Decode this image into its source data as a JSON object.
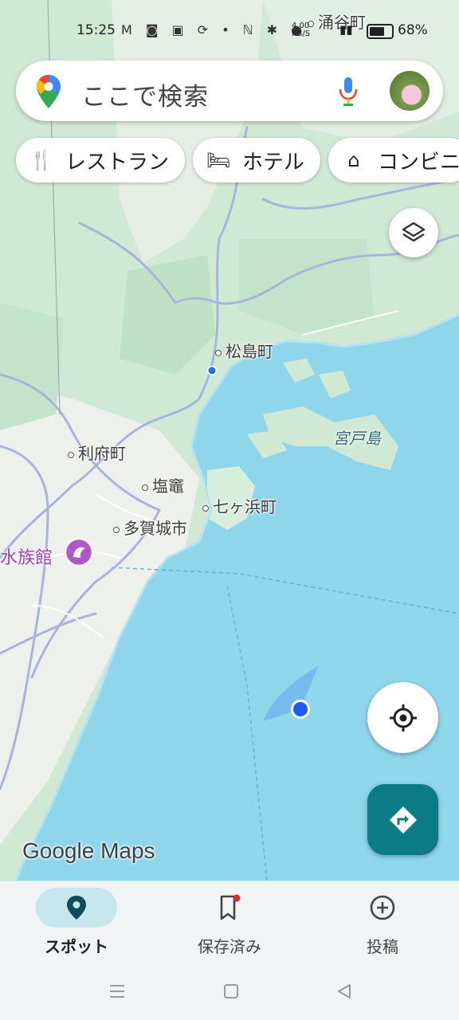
{
  "status_bar": {
    "time": "15:25",
    "network_speed": "4.00 KB/S",
    "battery": "68%"
  },
  "search": {
    "placeholder": "ここで検索"
  },
  "chips": [
    {
      "label": "レストラン",
      "icon": "fork-knife-icon"
    },
    {
      "label": "ホテル",
      "icon": "bed-icon"
    },
    {
      "label": "コンビニ",
      "icon": "store-icon"
    }
  ],
  "map_labels": {
    "wakuya": "涌谷町",
    "matsushima": "松島町",
    "miyatojima": "宮戸島",
    "rifu": "利府町",
    "shiogama": "塩竈",
    "shichigahama": "七ヶ浜町",
    "tagajo": "多賀城市",
    "aquarium": "水族館"
  },
  "logo": "Google Maps",
  "bottom_nav": [
    {
      "label": "スポット",
      "icon": "pin-icon",
      "active": true
    },
    {
      "label": "保存済み",
      "icon": "bookmark-icon",
      "active": false
    },
    {
      "label": "投稿",
      "icon": "add-circle-icon",
      "active": false
    }
  ],
  "colors": {
    "water": "#8fd6ea",
    "land": "#f2f3ef",
    "green": "#cfe9d4",
    "accent": "#0b7c86",
    "location": "#1a5cf5"
  }
}
